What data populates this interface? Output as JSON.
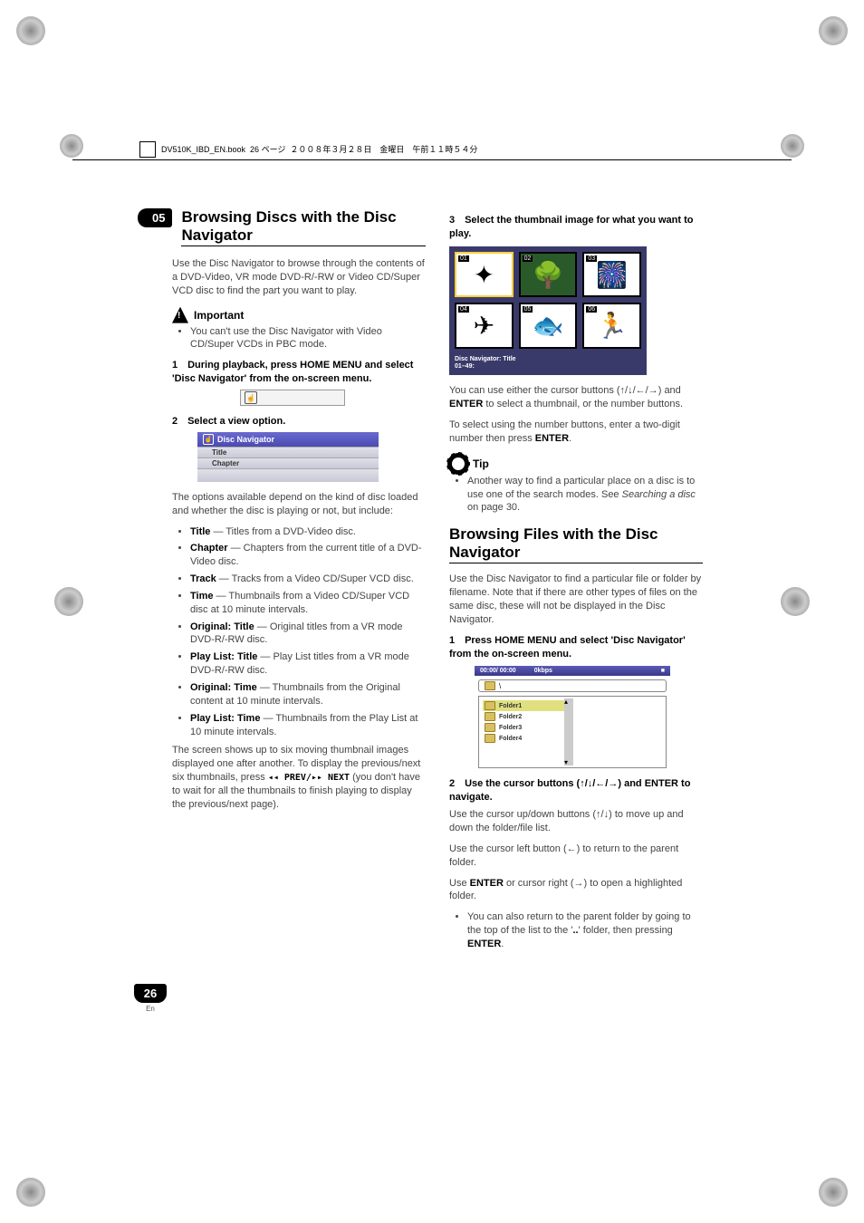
{
  "header_text": "DV510K_IBD_EN.book  26 ページ  ２００８年３月２８日　金曜日　午前１１時５４分",
  "chapter_badge": "05",
  "page_number": "26",
  "page_lang": "En",
  "left": {
    "h1": "Browsing Discs with the Disc Navigator",
    "intro": "Use the Disc Navigator to browse through the contents of a DVD-Video, VR mode DVD-R/-RW or Video CD/Super VCD disc to find the part you want to play.",
    "important_label": "Important",
    "important_bullet": "You can't use the Disc Navigator with Video CD/Super VCDs in PBC mode.",
    "step1": "During playback, press HOME MENU and select 'Disc Navigator' from the on-screen menu.",
    "step2": "Select a view option.",
    "nav_header": "Disc Navigator",
    "nav_row1": "Title",
    "nav_row2": "Chapter",
    "options_intro": "The options available depend on the kind of disc loaded and whether the disc is playing or not, but include:",
    "opts": [
      {
        "b": "Title",
        "rest": " — Titles from a DVD-Video disc."
      },
      {
        "b": "Chapter",
        "rest": " — Chapters from the current title of a DVD-Video disc."
      },
      {
        "b": "Track",
        "rest": " — Tracks from a Video CD/Super VCD disc."
      },
      {
        "b": "Time",
        "rest": " — Thumbnails from a Video CD/Super VCD disc at 10 minute intervals."
      },
      {
        "b": "Original: Title",
        "rest": " — Original titles from a VR mode DVD-R/-RW disc."
      },
      {
        "b": "Play List: Title",
        "rest": " — Play List titles from a VR mode DVD-R/-RW disc."
      },
      {
        "b": "Original: Time",
        "rest": " — Thumbnails from the Original content at 10 minute intervals."
      },
      {
        "b": "Play List: Time",
        "rest": " — Thumbnails from the Play List at 10 minute intervals."
      }
    ],
    "after_opts_1": "The screen shows up to six moving thumbnail images displayed one after another. To display the previous/next six thumbnails, press ",
    "after_opts_transport": "◂◂ PREV/▸▸ NEXT",
    "after_opts_2": " (you don't have to wait for all the thumbnails to finish playing to display the previous/next page)."
  },
  "right": {
    "step3": "Select the thumbnail image for what you want to play.",
    "thumbs": {
      "footer_l1": "Disc Navigator: Title",
      "footer_l2": "01–49: ",
      "items": [
        "01",
        "02",
        "03",
        "04",
        "05",
        "06"
      ]
    },
    "para_cursor_1": "You can use either the cursor buttons (",
    "para_cursor_arrows": "↑/↓/←/→",
    "para_cursor_2": ") and ",
    "para_cursor_enter": "ENTER",
    "para_cursor_3": " to select a thumbnail, or the number buttons.",
    "para_number": "To select using the number buttons, enter a two-digit number then press ",
    "para_number_enter": "ENTER",
    "para_number_end": ".",
    "tip_label": "Tip",
    "tip_bullet_1": "Another way to find a particular place on a disc is to use one of the search modes. See ",
    "tip_bullet_italic": "Searching a disc",
    "tip_bullet_2": " on page 30.",
    "h2": "Browsing Files with the Disc Navigator",
    "files_intro": "Use the Disc Navigator to find a particular file or folder by filename. Note that if there are other types of files on the same disc, these will not be displayed in the Disc Navigator.",
    "files_step1": "Press HOME MENU and select 'Disc Navigator' from the on-screen menu.",
    "filebox": {
      "time": "00:00/ 00:00",
      "rate": "0kbps",
      "folders": [
        "Folder1",
        "Folder2",
        "Folder3",
        "Folder4"
      ]
    },
    "files_step2_a": "Use the cursor buttons (",
    "files_step2_arrows": "↑/↓/←/→",
    "files_step2_b": ") and ENTER to navigate.",
    "files_p_up_a": "Use the cursor up/down buttons (",
    "files_p_up_arrows": "↑/↓",
    "files_p_up_b": ") to move up and down the folder/file list.",
    "files_p_left_a": "Use the cursor left button (",
    "files_p_left_arrow": "←",
    "files_p_left_b": ") to return to the parent folder.",
    "files_p_enter_a": "Use ",
    "files_p_enter_kbd": "ENTER",
    "files_p_enter_b": " or cursor right (",
    "files_p_enter_arrow": "→",
    "files_p_enter_c": ") to open a highlighted folder.",
    "files_bullet_a": "You can also return to the parent folder by going to the top of the list to the '",
    "files_bullet_dots": "..",
    "files_bullet_b": "' folder, then pressing ",
    "files_bullet_enter": "ENTER",
    "files_bullet_end": "."
  }
}
